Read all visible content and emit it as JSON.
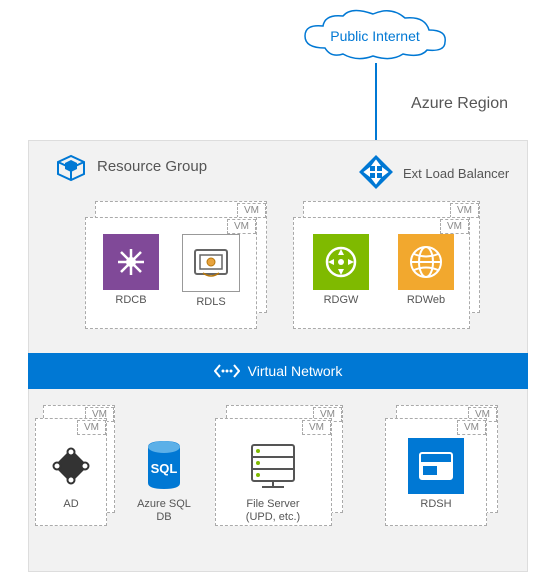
{
  "cloud": {
    "label": "Public Internet"
  },
  "region": {
    "label": "Azure Region"
  },
  "resourceGroup": {
    "label": "Resource Group"
  },
  "loadBalancer": {
    "label": "Ext Load Balancer"
  },
  "vnet": {
    "label": "Virtual Network"
  },
  "vmTag": "VM",
  "services": {
    "rdcb": {
      "label": "RDCB",
      "color": "#804998"
    },
    "rdls": {
      "label": "RDLS",
      "color": "#ffffff"
    },
    "rdgw": {
      "label": "RDGW",
      "color": "#7fba00"
    },
    "rdweb": {
      "label": "RDWeb",
      "color": "#f2a82e"
    },
    "ad": {
      "label": "AD",
      "color": "#ffffff"
    },
    "sqldb": {
      "label": "Azure SQL DB",
      "color": "#0078d4"
    },
    "fileserver": {
      "label": "File Server (UPD, etc.)",
      "color": "#ffffff"
    },
    "rdsh": {
      "label": "RDSH",
      "color": "#0078d4"
    }
  }
}
